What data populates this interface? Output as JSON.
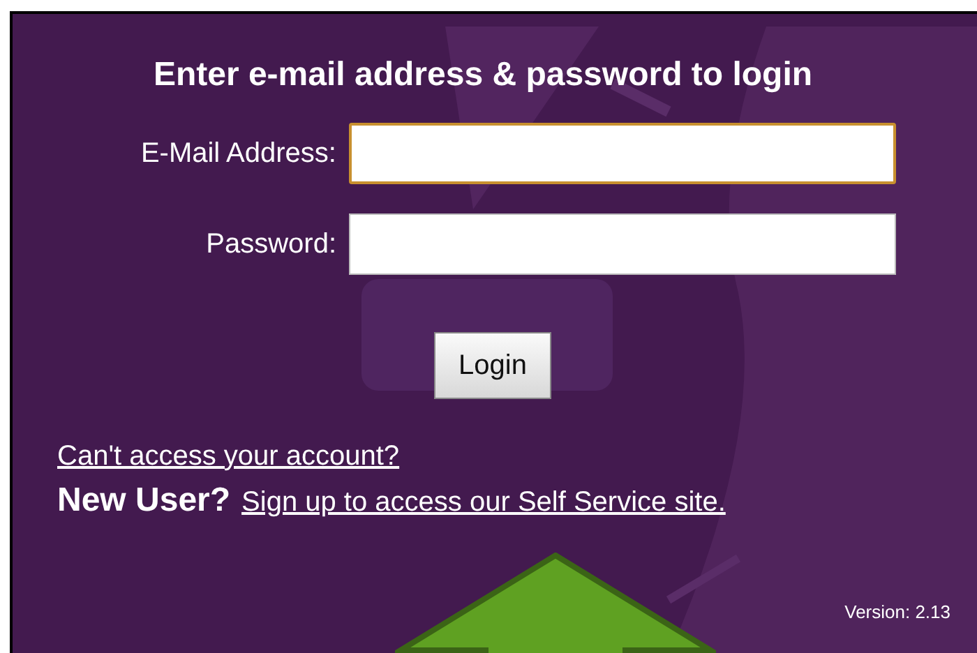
{
  "heading": "Enter e-mail address & password to login",
  "fields": [
    {
      "label": "E-Mail Address:",
      "focused": true
    },
    {
      "label": "Password:",
      "focused": false
    }
  ],
  "login_button": "Login",
  "forgot_link": "Can't access your account?",
  "new_user": {
    "label": "New User?",
    "link": "Sign up to access our Self Service site."
  },
  "version": "Version: 2.13"
}
